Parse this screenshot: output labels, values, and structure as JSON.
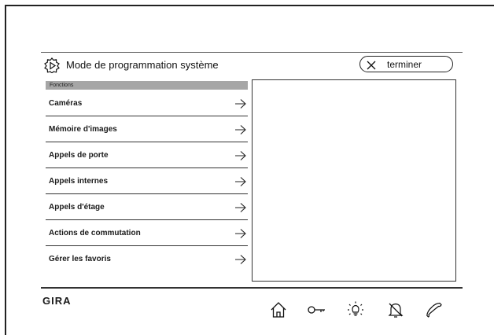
{
  "screen": {
    "title": "Mode de programmation système",
    "finish_label": "terminer"
  },
  "section": {
    "label": "Fonctions"
  },
  "menu": {
    "items": [
      {
        "label": "Caméras"
      },
      {
        "label": "Mémoire d'images"
      },
      {
        "label": "Appels de porte"
      },
      {
        "label": "Appels internes"
      },
      {
        "label": "Appels d'étage"
      },
      {
        "label": "Actions de commutation"
      },
      {
        "label": "Gérer les favoris"
      }
    ]
  },
  "footer": {
    "brand": "GIRA",
    "icons": [
      "home-icon",
      "key-icon",
      "light-icon",
      "bell-off-icon",
      "phone-icon"
    ]
  }
}
